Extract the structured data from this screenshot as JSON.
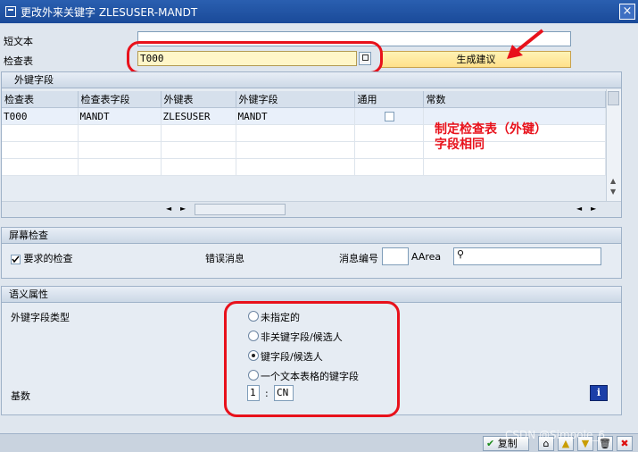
{
  "window": {
    "title": "更改外来关键字 ZLESUSER-MANDT",
    "close": "×"
  },
  "form": {
    "short_text_label": "短文本",
    "check_table_label": "检查表",
    "check_table_value": "T000",
    "suggest_button": "生成建议"
  },
  "fk_fields": {
    "title": "外键字段",
    "columns": [
      "检查表",
      "检查表字段",
      "外键表",
      "外键字段",
      "通用",
      "常数"
    ],
    "rows": [
      [
        "T000",
        "MANDT",
        "ZLESUSER",
        "MANDT",
        "",
        ""
      ]
    ]
  },
  "annotation": {
    "line1": "制定检查表（外键）",
    "line2": "字段相同"
  },
  "screen_check": {
    "title": "屏幕检查",
    "required_check": "要求的检查",
    "error_message": "错误消息",
    "msg_no": "消息编号",
    "aarea": "AArea"
  },
  "semantic": {
    "title": "语义属性",
    "fk_type_label": "外键字段类型",
    "options": [
      "未指定的",
      "非关键字段/候选人",
      "键字段/候选人",
      "一个文本表格的键字段"
    ],
    "selected_index": 2,
    "cardinality_label": "基数",
    "card_left": "1",
    "card_sep": ":",
    "card_right": "CN"
  },
  "toolbar": {
    "copy": "复制",
    "watermark": "CSDN @Simpole_6"
  },
  "colors": {
    "title_bg": "#1a4a99",
    "annotation": "#e8111b",
    "ring": "#e8111b"
  }
}
